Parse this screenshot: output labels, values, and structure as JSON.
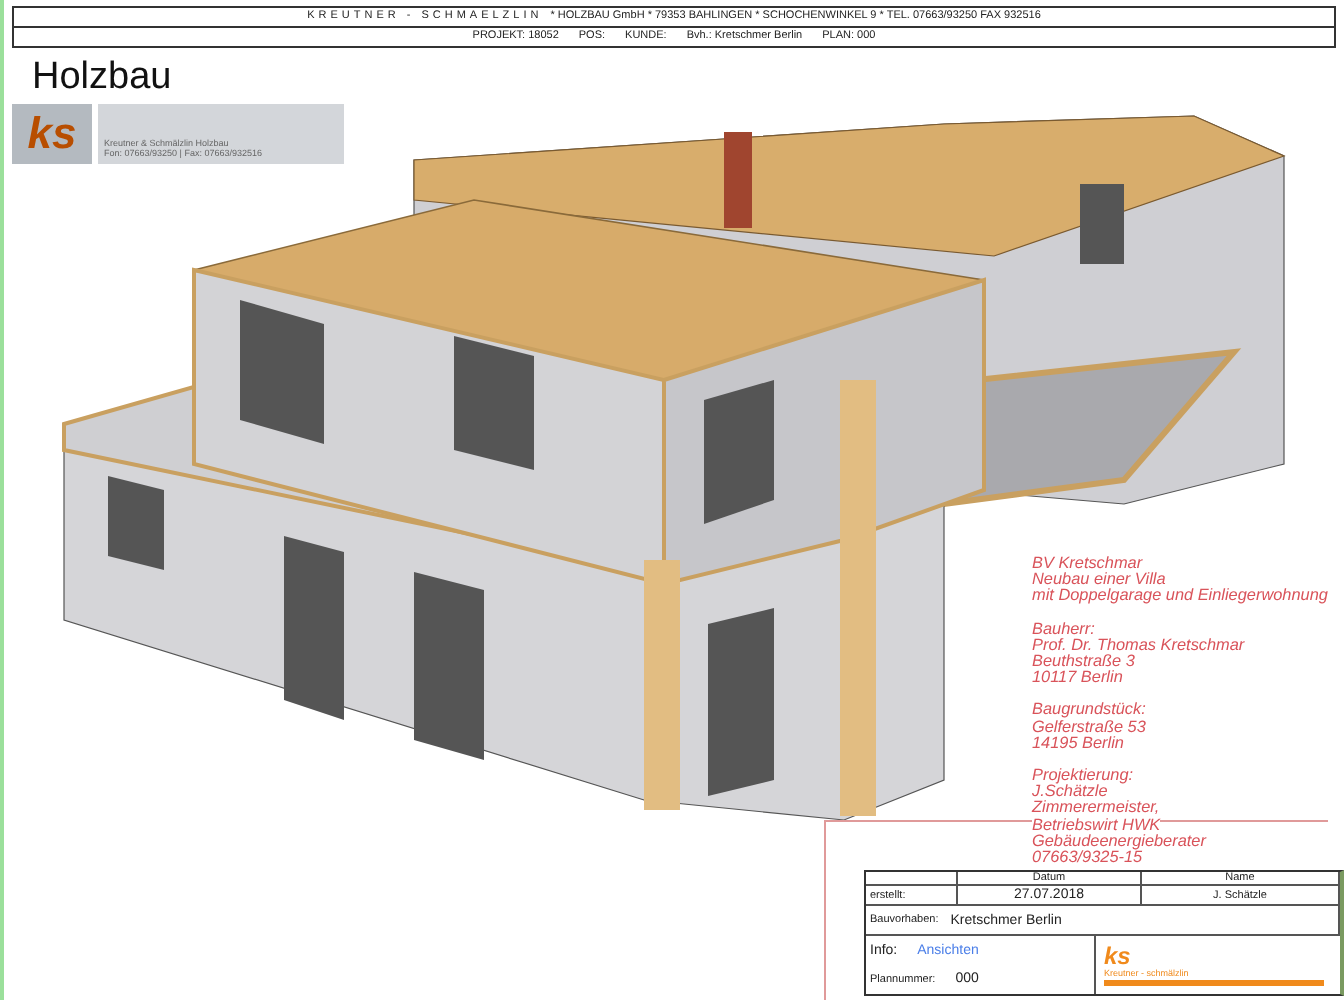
{
  "header": {
    "company_name": "KREUTNER - SCHMAELZLIN",
    "company_details": "* HOLZBAU GmbH * 79353 BAHLINGEN * SCHOCHENWINKEL 9 * TEL. 07663/93250 FAX 932516",
    "project_fields": [
      "PROJEKT: 18052",
      "POS:",
      "KUNDE:",
      "Bvh.: Kretschmer Berlin",
      "PLAN: 000"
    ]
  },
  "title": "Holzbau",
  "logo": {
    "mark": "ks",
    "lines": [
      "Kreutner & Schmälzlin Holzbau",
      "Fon: 07663/93250 | Fax: 07663/932516"
    ]
  },
  "project_info": [
    {
      "lines": [
        "BV Kretschmar",
        "Neubau einer Villa",
        "mit Doppelgarage und Einliegerwohnung"
      ]
    },
    {
      "lines": [
        "Bauherr:",
        "Prof. Dr. Thomas Kretschmar",
        "Beuthstraße 3",
        "10117 Berlin"
      ]
    },
    {
      "lines": [
        "Baugrundstück:",
        "Gelferstraße 53",
        "14195 Berlin"
      ]
    },
    {
      "lines": [
        "Projektierung:",
        "J.Schätzle",
        "Zimmerermeister,",
        "Betriebswirt HWK",
        "Gebäudeenergieberater",
        "07663/9325-15"
      ]
    }
  ],
  "title_block": {
    "date_heading": "Datum",
    "name_heading": "Name",
    "created_label": "erstellt:",
    "date": "27.07.2018",
    "name": "J. Schätzle",
    "project_label": "Bauvorhaben:",
    "project": "Kretschmer Berlin",
    "info_label": "Info:",
    "info": "Ansichten",
    "plan_label": "Plannummer:",
    "plan": "000",
    "logo_mark": "ks",
    "logo_name": "Kreutner - schmälzlin"
  }
}
